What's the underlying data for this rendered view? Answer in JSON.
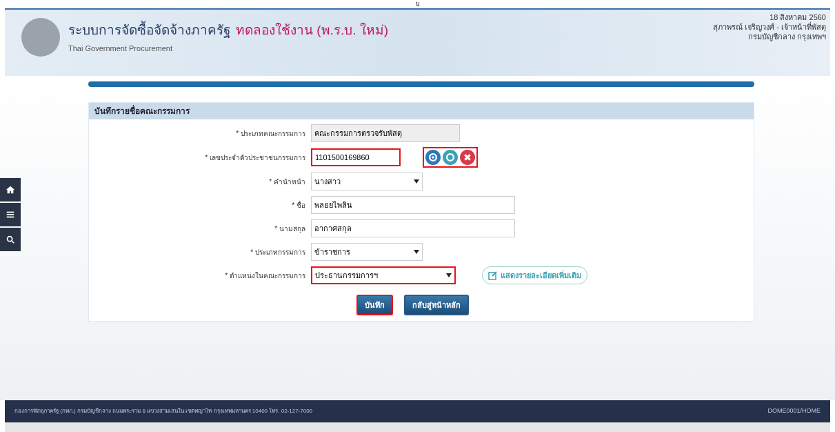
{
  "top_mark": "บ",
  "header": {
    "title": "ระบบการจัดซื้อจัดจ้างภาครัฐ",
    "title_suffix": "ทดลองใช้งาน (พ.ร.บ. ใหม่)",
    "subtitle": "Thai Government Procurement",
    "date": "18 สิงหาคม 2560",
    "user": "สุภาพรณ์ เจริญวงศ์ - เจ้าหน้าที่พัสดุ",
    "org": "กรมบัญชีกลาง กรุงเทพฯ"
  },
  "form": {
    "title": "บันทึกรายชื่อคณะกรรมการ",
    "fields": [
      {
        "kind": "readonly",
        "label": "* ประเภทคณะกรรมการ",
        "value": "คณะกรรมการตรวจรับพัสดุ",
        "highlighted": false
      },
      {
        "kind": "text",
        "label": "* เลขประจำตัวประชาชนกรรมการ",
        "value": "1101500169860",
        "highlighted": true,
        "lookup_buttons_highlighted": true
      },
      {
        "kind": "select",
        "label": "* คำนำหน้า",
        "value": "นางสาว",
        "highlighted": false
      },
      {
        "kind": "wide",
        "label": "* ชื่อ",
        "value": "พลอยไพลิน",
        "highlighted": false
      },
      {
        "kind": "wide",
        "label": "* นามสกุล",
        "value": "อากาศสกุล",
        "highlighted": false
      },
      {
        "kind": "select",
        "label": "* ประเภทกรรมการ",
        "value": "ข้าราชการ",
        "highlighted": false
      },
      {
        "kind": "select_wide",
        "label": "* ตำแหน่งในคณะกรรมการ",
        "value": "ประธานกรรมการฯ",
        "highlighted": true,
        "link": "แสดงรายละเอียดเพิ่มเติม"
      }
    ],
    "buttons": [
      {
        "label": "บันทึก",
        "highlighted": true
      },
      {
        "label": "กลับสู่หน้าหลัก",
        "highlighted": false
      }
    ]
  },
  "footer": {
    "address": "กองการพัสดุภาครัฐ (กพภ.) กรมบัญชีกลาง ถนนพระราม 6 แขวงสามเสนใน เขตพญาไท กรุงเทพมหานคร 10400 โทร. 02-127-7000",
    "code": "DOME0001/HOME"
  }
}
